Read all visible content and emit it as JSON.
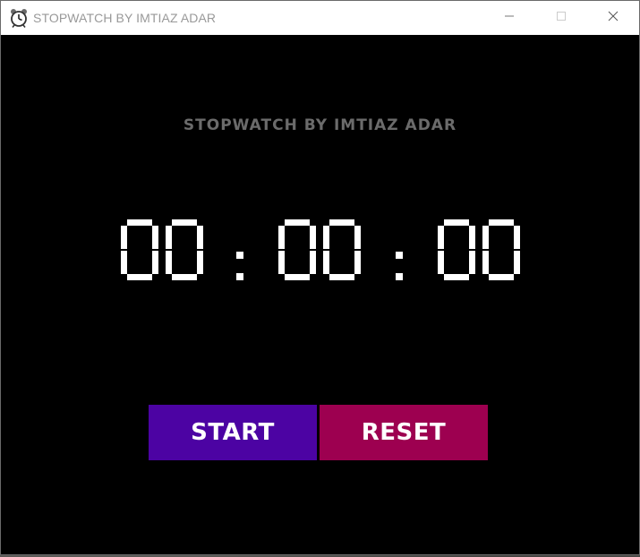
{
  "window": {
    "title": "STOPWATCH BY IMTIAZ ADAR",
    "controls": [
      "minimize",
      "maximize",
      "close"
    ]
  },
  "app": {
    "heading": "STOPWATCH BY IMTIAZ ADAR",
    "time_display": {
      "hours": "00",
      "minutes": "00",
      "seconds": "00",
      "separator": ":"
    },
    "buttons": {
      "start_label": "START",
      "reset_label": "RESET"
    }
  },
  "colors": {
    "background": "#000000",
    "heading": "#6b6b6b",
    "digits": "#ffffff",
    "start": "#4c03a3",
    "reset": "#9d0050"
  },
  "icons": [
    "alarm-clock-icon",
    "minimize-icon",
    "maximize-icon",
    "close-icon"
  ]
}
